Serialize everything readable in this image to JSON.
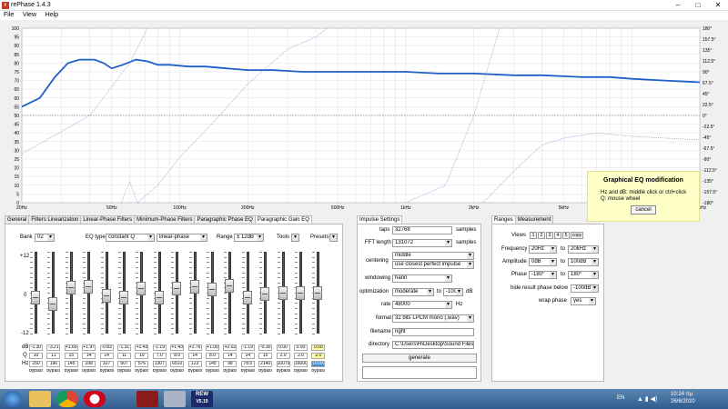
{
  "window": {
    "title": "rePhase 1.4.3",
    "icon": "rephase-app-icon"
  },
  "menu": [
    "File",
    "View",
    "Help"
  ],
  "plot": {
    "y_left_ticks": [
      "100",
      "95",
      "90",
      "85",
      "80",
      "75",
      "70",
      "65",
      "60",
      "55",
      "50",
      "45",
      "40",
      "35",
      "30",
      "25",
      "20",
      "15",
      "10",
      "5",
      "0"
    ],
    "y_right_ticks": [
      "180°",
      "157.5°",
      "135°",
      "112.5°",
      "90°",
      "67.5°",
      "45°",
      "22.5°",
      "0°",
      "-22.5°",
      "-45°",
      "-67.5°",
      "-90°",
      "-112.5°",
      "-135°",
      "-157.5°",
      "-180°"
    ],
    "x_ticks": [
      "20Hz",
      "50Hz",
      "100Hz",
      "200Hz",
      "500Hz",
      "1kHz",
      "2kHz",
      "5kHz",
      "10kHz",
      "20kHz"
    ],
    "colors": {
      "curve": "#1e5fc8",
      "dotted": "#6b8fd8",
      "grid": "#d8d8d8"
    }
  },
  "tooltip": {
    "title": "Graphical EQ modification",
    "line1": "Hz and dB: middle click or ctrl+click",
    "line2": "Q: mouse wheel",
    "cancel": "cancel"
  },
  "left_tabs": [
    "General",
    "Filters Linearization",
    "Linear-Phase Filters",
    "Minimum-Phase Filters",
    "Paragraphic Phase EQ",
    "Paragraphic Gain EQ"
  ],
  "gain_eq": {
    "bank_label": "Bank",
    "bank_value": "02",
    "eq_type_label": "EQ type",
    "eq_type_value": "constant Q",
    "phase_value": "linear-phase",
    "range_label": "Range",
    "range_value": "± 12dB",
    "tools_label": "Tools",
    "presets_label": "Presets",
    "scale_top": "+12",
    "scale_mid": "0",
    "scale_bot": "-12",
    "row_labels": [
      "dB",
      "Q",
      "Hz"
    ],
    "bands": [
      {
        "db": "-1.30",
        "q": "10",
        "hz": "250",
        "type": "bypass",
        "level": 0.446
      },
      {
        "db": "-3.21",
        "q": "11",
        "hz": "196",
        "type": "bypass",
        "level": 0.366
      },
      {
        "db": "+1.66",
        "q": "15",
        "hz": "145",
        "type": "bypass",
        "level": 0.569
      },
      {
        "db": "+1.97",
        "q": "14",
        "hz": "298",
        "type": "bypass",
        "level": 0.582
      },
      {
        "db": "-0.83",
        "q": "14",
        "hz": "327",
        "type": "bypass",
        "level": 0.465
      },
      {
        "db": "-1.31",
        "q": "11",
        "hz": "507",
        "type": "bypass",
        "level": 0.445
      },
      {
        "db": "+1.43",
        "q": "19",
        "hz": "576",
        "type": "bypass",
        "level": 0.56
      },
      {
        "db": "-1.19",
        "q": "7.0",
        "hz": "1307",
        "type": "bypass",
        "level": 0.45
      },
      {
        "db": "+1.43",
        "q": "8.0",
        "hz": "6510",
        "type": "bypass",
        "level": 0.56
      },
      {
        "db": "+1.76",
        "q": "14",
        "hz": "123",
        "type": "bypass",
        "level": 0.573
      },
      {
        "db": "+1.00",
        "q": "8.0",
        "hz": "145",
        "type": "bypass",
        "level": 0.542
      },
      {
        "db": "+2.02",
        "q": "14",
        "hz": "98",
        "type": "bypass",
        "level": 0.584
      },
      {
        "db": "-1.19",
        "q": "14",
        "hz": "78.5",
        "type": "bypass",
        "level": 0.45
      },
      {
        "db": "-0.30",
        "q": "15",
        "hz": "2140",
        "type": "bypass",
        "level": 0.488
      },
      {
        "db": "0.00",
        "q": "2.0",
        "hz": "10079",
        "type": "bypass",
        "level": 0.5
      },
      {
        "db": "0.00",
        "q": "2.0",
        "hz": "16000",
        "type": "bypass",
        "level": 0.5
      },
      {
        "db": "0.00",
        "q": "2.0",
        "hz": "16000",
        "type": "bypass",
        "level": 0.5
      }
    ]
  },
  "impulse": {
    "tab": "Impulse Settings",
    "taps_label": "taps",
    "taps_value": "32768",
    "taps_unit": "samples",
    "fft_label": "FFT length",
    "fft_value": "131072",
    "fft_unit": "samples",
    "centering_label": "centering",
    "centering_value": "middle",
    "centering_sub": "use closest perfect impulse",
    "windowing_label": "windowing",
    "windowing_value": "hann",
    "optimization_label": "optimization",
    "optimization_value": "moderate",
    "opt_to": "to",
    "opt_db_value": "-100",
    "opt_db_unit": "dB",
    "rate_label": "rate",
    "rate_value": "48000",
    "rate_unit": "Hz",
    "format_label": "format",
    "format_value": "32 bits LPCM mono (.wav)",
    "filename_label": "filename",
    "filename_value": "right",
    "directory_label": "directory",
    "directory_value": "C:\\Users\\H\\Desktop\\Sound Files",
    "generate": "generate"
  },
  "ranges": {
    "tabs": [
      "Ranges",
      "Measurement"
    ],
    "views_label": "Views",
    "views": [
      "1",
      "2",
      "3",
      "4",
      "5"
    ],
    "copy": "copy",
    "frequency_label": "Frequency",
    "freq_from": "20Hz",
    "freq_to": "20kHz",
    "amplitude_label": "Amplitude",
    "amp_from": "0dB",
    "amp_to": "100dB",
    "phase_label": "Phase",
    "phase_from": "-180°",
    "phase_to": "180°",
    "to": "to",
    "hide_label": "hide result phase below",
    "hide_value": "-100dB",
    "wrap_label": "wrap phase",
    "wrap_value": "yes"
  },
  "taskbar": {
    "lang": "EN",
    "time": "10:24 πμ",
    "date": "26/6/2020",
    "apps": [
      "start-orb",
      "file-explorer-icon",
      "chrome-icon",
      "opera-icon",
      "rephase-icon",
      "paint-icon",
      "rew-icon"
    ],
    "rew_label": "REW",
    "rew_sub": "V5.19"
  }
}
